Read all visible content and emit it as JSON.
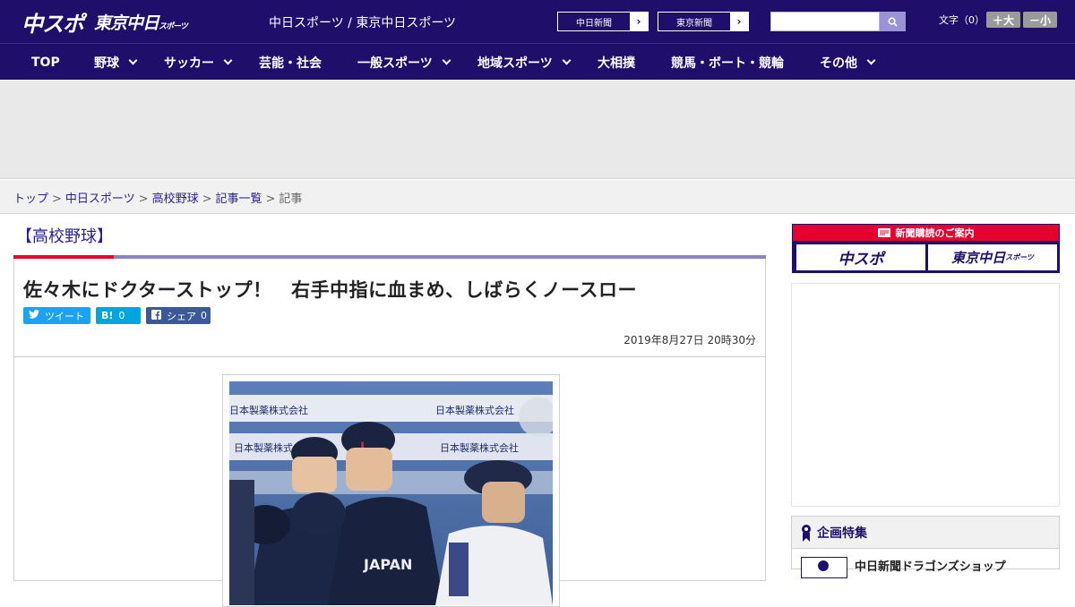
{
  "header": {
    "logo_main": "中スポ",
    "logo_sub": "東京中日",
    "logo_sub_small": "スポーツ",
    "site_title": "中日スポーツ / 東京中日スポーツ",
    "papers": [
      {
        "label": "中日新聞",
        "arrow": "›"
      },
      {
        "label": "東京新聞",
        "arrow": "›"
      }
    ],
    "search_placeholder": "",
    "font_size_label": "文字（0）",
    "font_larger": "＋大",
    "font_smaller": "－小"
  },
  "nav": {
    "items": [
      {
        "label": "TOP",
        "dropdown": false
      },
      {
        "label": "野球",
        "dropdown": true
      },
      {
        "label": "サッカー",
        "dropdown": true
      },
      {
        "label": "芸能・社会",
        "dropdown": false
      },
      {
        "label": "一般スポーツ",
        "dropdown": true
      },
      {
        "label": "地域スポーツ",
        "dropdown": true
      },
      {
        "label": "大相撲",
        "dropdown": false
      },
      {
        "label": "競馬・ボート・競輪",
        "dropdown": false
      },
      {
        "label": "その他",
        "dropdown": true
      }
    ]
  },
  "breadcrumb": [
    {
      "label": "トップ",
      "link": true
    },
    {
      "label": "中日スポーツ",
      "link": true
    },
    {
      "label": "高校野球",
      "link": true
    },
    {
      "label": "記事一覧",
      "link": true
    },
    {
      "label": "記事",
      "link": false
    }
  ],
  "breadcrumb_sep": ">",
  "article": {
    "category": "【高校野球】",
    "headline": "佐々木にドクターストップ！　右手中指に血まめ、しばらくノースロー",
    "share": {
      "tweet_label": "ツイート",
      "hatena_label": "B!",
      "hatena_count": "0",
      "facebook_label": "シェア",
      "facebook_count": "0"
    },
    "date": "2019年8月27日 20時30分",
    "photo_banner_text": [
      "日本製薬株式会社",
      "日本製薬株式会社",
      "日本製薬株式会社",
      "日本製薬株式会社"
    ],
    "jersey_text": "JAPAN"
  },
  "sidebar": {
    "promo_title": "新聞購読のご案内",
    "promo_tiles": [
      "中スポ",
      "東京中日"
    ],
    "promo_tile_small": "スポーツ",
    "feature_title": "企画特集",
    "feature_item": "中日新聞ドラゴンズショップ"
  },
  "colors": {
    "brand_navy": "#1f0f6b",
    "accent_red": "#e6002d",
    "rule_purple": "#8a84c6",
    "twitter": "#1da1f2",
    "hatena": "#00a4de",
    "facebook": "#3b5998"
  }
}
